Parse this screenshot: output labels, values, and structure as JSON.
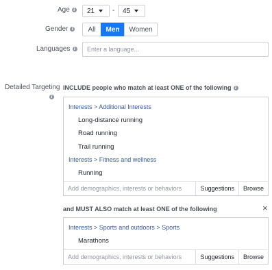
{
  "age": {
    "label": "Age",
    "min": "21",
    "dash": "-",
    "max": "45"
  },
  "gender": {
    "label": "Gender",
    "options": [
      "All",
      "Men",
      "Women"
    ],
    "selected": "Men"
  },
  "languages": {
    "label": "Languages",
    "placeholder": "Enter a language..."
  },
  "detailed_targeting": {
    "label": "Detailed Targeting",
    "include_heading": "INCLUDE people who match at least ONE of the following",
    "include_groups": [
      {
        "path": "Interests > Additional Interests",
        "items": [
          "Long-distance running",
          "Road running",
          "Trail running"
        ]
      },
      {
        "path": "Interests > Fitness and wellness",
        "items": [
          "Running"
        ]
      }
    ],
    "must_heading": "and MUST ALSO match at least ONE of the following",
    "must_groups": [
      {
        "path": "Interests > Sports and outdoors > Sports",
        "items": [
          "Marathons"
        ]
      }
    ],
    "add_placeholder": "Add demographics, interests or behaviors",
    "suggestions_label": "Suggestions",
    "browse_label": "Browse",
    "close_glyph": "×"
  },
  "info_glyph": "i",
  "colors": {
    "accent": "#1877f2",
    "link": "#365899",
    "border": "#ccd0d5"
  }
}
